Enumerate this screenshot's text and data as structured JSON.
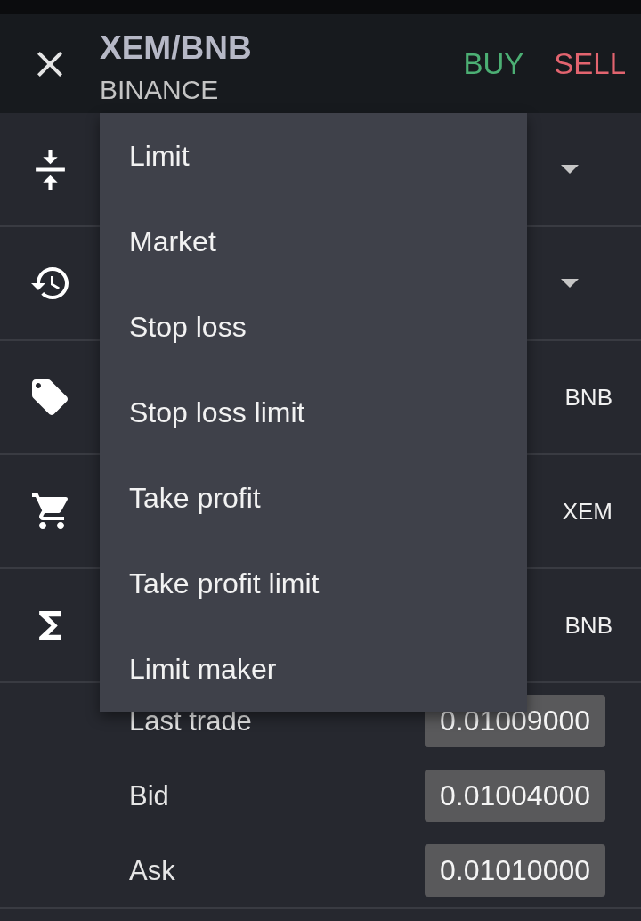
{
  "header": {
    "title": "XEM/BNB",
    "subtitle": "BINANCE",
    "actions": [
      {
        "kind": "buy",
        "label": "BUY"
      },
      {
        "kind": "sell",
        "label": "SELL"
      }
    ]
  },
  "order_rows": [
    {
      "kind": "select"
    },
    {
      "kind": "select"
    },
    {
      "kind": "input",
      "unit": "BNB"
    },
    {
      "kind": "input",
      "unit": "XEM"
    },
    {
      "kind": "input",
      "unit": "BNB"
    }
  ],
  "prices": [
    {
      "label": "Last trade",
      "value": "0.01009000"
    },
    {
      "label": "Bid",
      "value": "0.01004000"
    },
    {
      "label": "Ask",
      "value": "0.01010000"
    }
  ],
  "order_type_menu": {
    "items": [
      "Limit",
      "Market",
      "Stop loss",
      "Stop loss limit",
      "Take profit",
      "Take profit limit",
      "Limit maker"
    ]
  }
}
